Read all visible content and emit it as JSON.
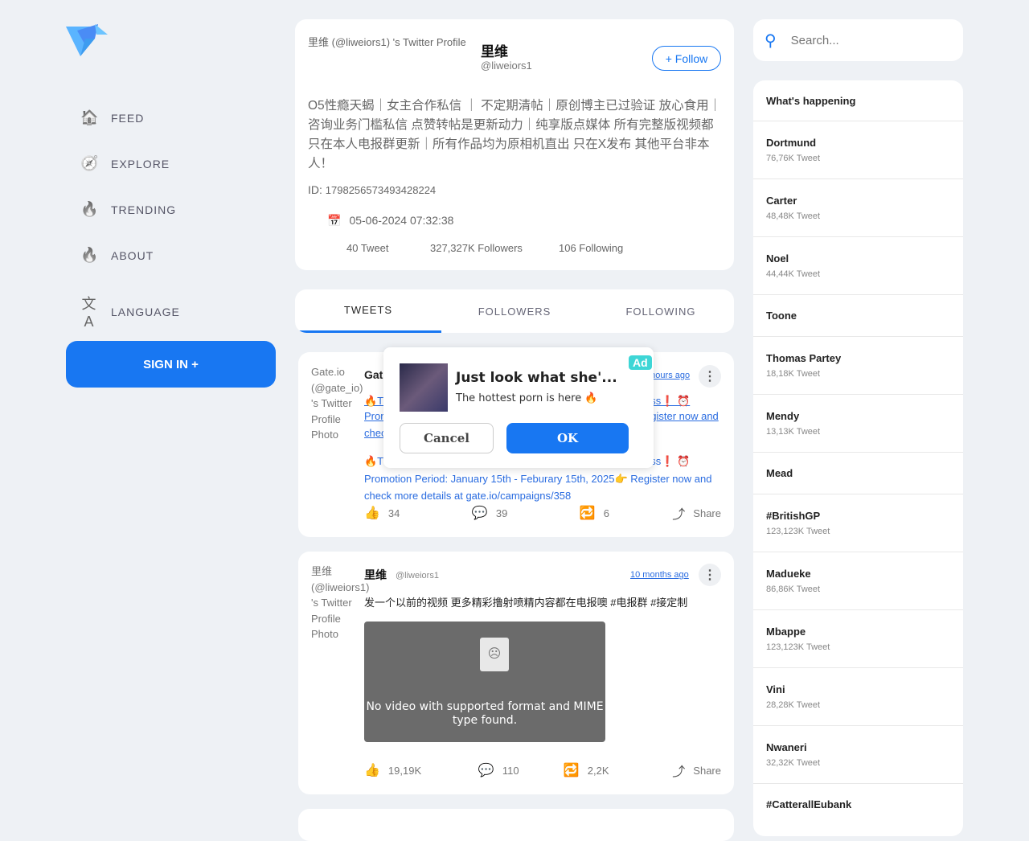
{
  "nav": {
    "items": [
      {
        "label": "FEED",
        "icon": "home-icon"
      },
      {
        "label": "EXPLORE",
        "icon": "compass-icon"
      },
      {
        "label": "TRENDING",
        "icon": "fire-icon"
      },
      {
        "label": "ABOUT",
        "icon": "fire-icon"
      },
      {
        "label": "LANGUAGE",
        "icon": "translate-icon"
      }
    ],
    "signin": "SIGN IN +"
  },
  "profile": {
    "page_title": "里维 (@liweiors1) 's Twitter Profile",
    "name": "里维",
    "handle": "@liweiors1",
    "follow": "+ Follow",
    "bio": "O5性瘾天蝎｜女主合作私信 ｜ 不定期清帖｜原创博主已过验证 放心食用｜咨询业务门槛私信 点赞转帖是更新动力｜纯享版点媒体 所有完整版视频都只在本人电报群更新｜所有作品均为原相机直出 只在X发布 其他平台非本人！",
    "id_label": "ID:",
    "id": "1798256573493428224",
    "joined": "05-06-2024 07:32:38",
    "tweets": "40 Tweet",
    "followers": "327,327K Followers",
    "following": "106 Following"
  },
  "tabs": [
    "TWEETS",
    "FOLLOWERS",
    "FOLLOWING"
  ],
  "tweets": [
    {
      "side": "Gate.io (@gate_io) 's Twitter Profile Photo",
      "name": "Gat",
      "time": "5 hours ago",
      "l1a": "🔥Th",
      "l1b": "ess❗ ⏰",
      "l2a": "Pron",
      "l2b": "egister now and",
      "l3": "chec",
      "l4a": "🔥Th",
      "l4b": "ess❗ ⏰",
      "l5": "Promotion Period: January 15th - Feburary 15th, 2025👉 Register now and check more details at gate.io/campaigns/358",
      "likes": "34",
      "replies": "39",
      "retweets": "6",
      "share": "Share"
    },
    {
      "side": "里维 (@liweiors1) 's Twitter Profile Photo",
      "name": "里维",
      "handle": "@liweiors1",
      "time": "10 months ago",
      "text": "发一个以前的视频 更多精彩撸射喷精内容都在电报噢 #电报群 #接定制",
      "video_error": "No video with supported format and MIME type found.",
      "likes": "19,19K",
      "replies": "110",
      "retweets": "2,2K",
      "share": "Share"
    }
  ],
  "ad": {
    "badge": "Ad",
    "title": "Just look what she'...",
    "text": "The hottest porn is here 🔥",
    "cancel": "Cancel",
    "ok": "OK"
  },
  "search": {
    "placeholder": "Search..."
  },
  "trends": {
    "title": "What's happening",
    "items": [
      {
        "name": "Dortmund",
        "count": "76,76K Tweet"
      },
      {
        "name": "Carter",
        "count": "48,48K Tweet"
      },
      {
        "name": "Noel",
        "count": "44,44K Tweet"
      },
      {
        "name": "Toone",
        "count": ""
      },
      {
        "name": "Thomas Partey",
        "count": "18,18K Tweet"
      },
      {
        "name": "Mendy",
        "count": "13,13K Tweet"
      },
      {
        "name": "Mead",
        "count": ""
      },
      {
        "name": "#BritishGP",
        "count": "123,123K Tweet"
      },
      {
        "name": "Madueke",
        "count": "86,86K Tweet"
      },
      {
        "name": "Mbappe",
        "count": "123,123K Tweet"
      },
      {
        "name": "Vini",
        "count": "28,28K Tweet"
      },
      {
        "name": "Nwaneri",
        "count": "32,32K Tweet"
      },
      {
        "name": "#CatterallEubank",
        "count": ""
      }
    ]
  },
  "colors": {
    "accent": "#1877f2",
    "background": "#eef1f5",
    "ad_badge": "#3ed6d6"
  }
}
